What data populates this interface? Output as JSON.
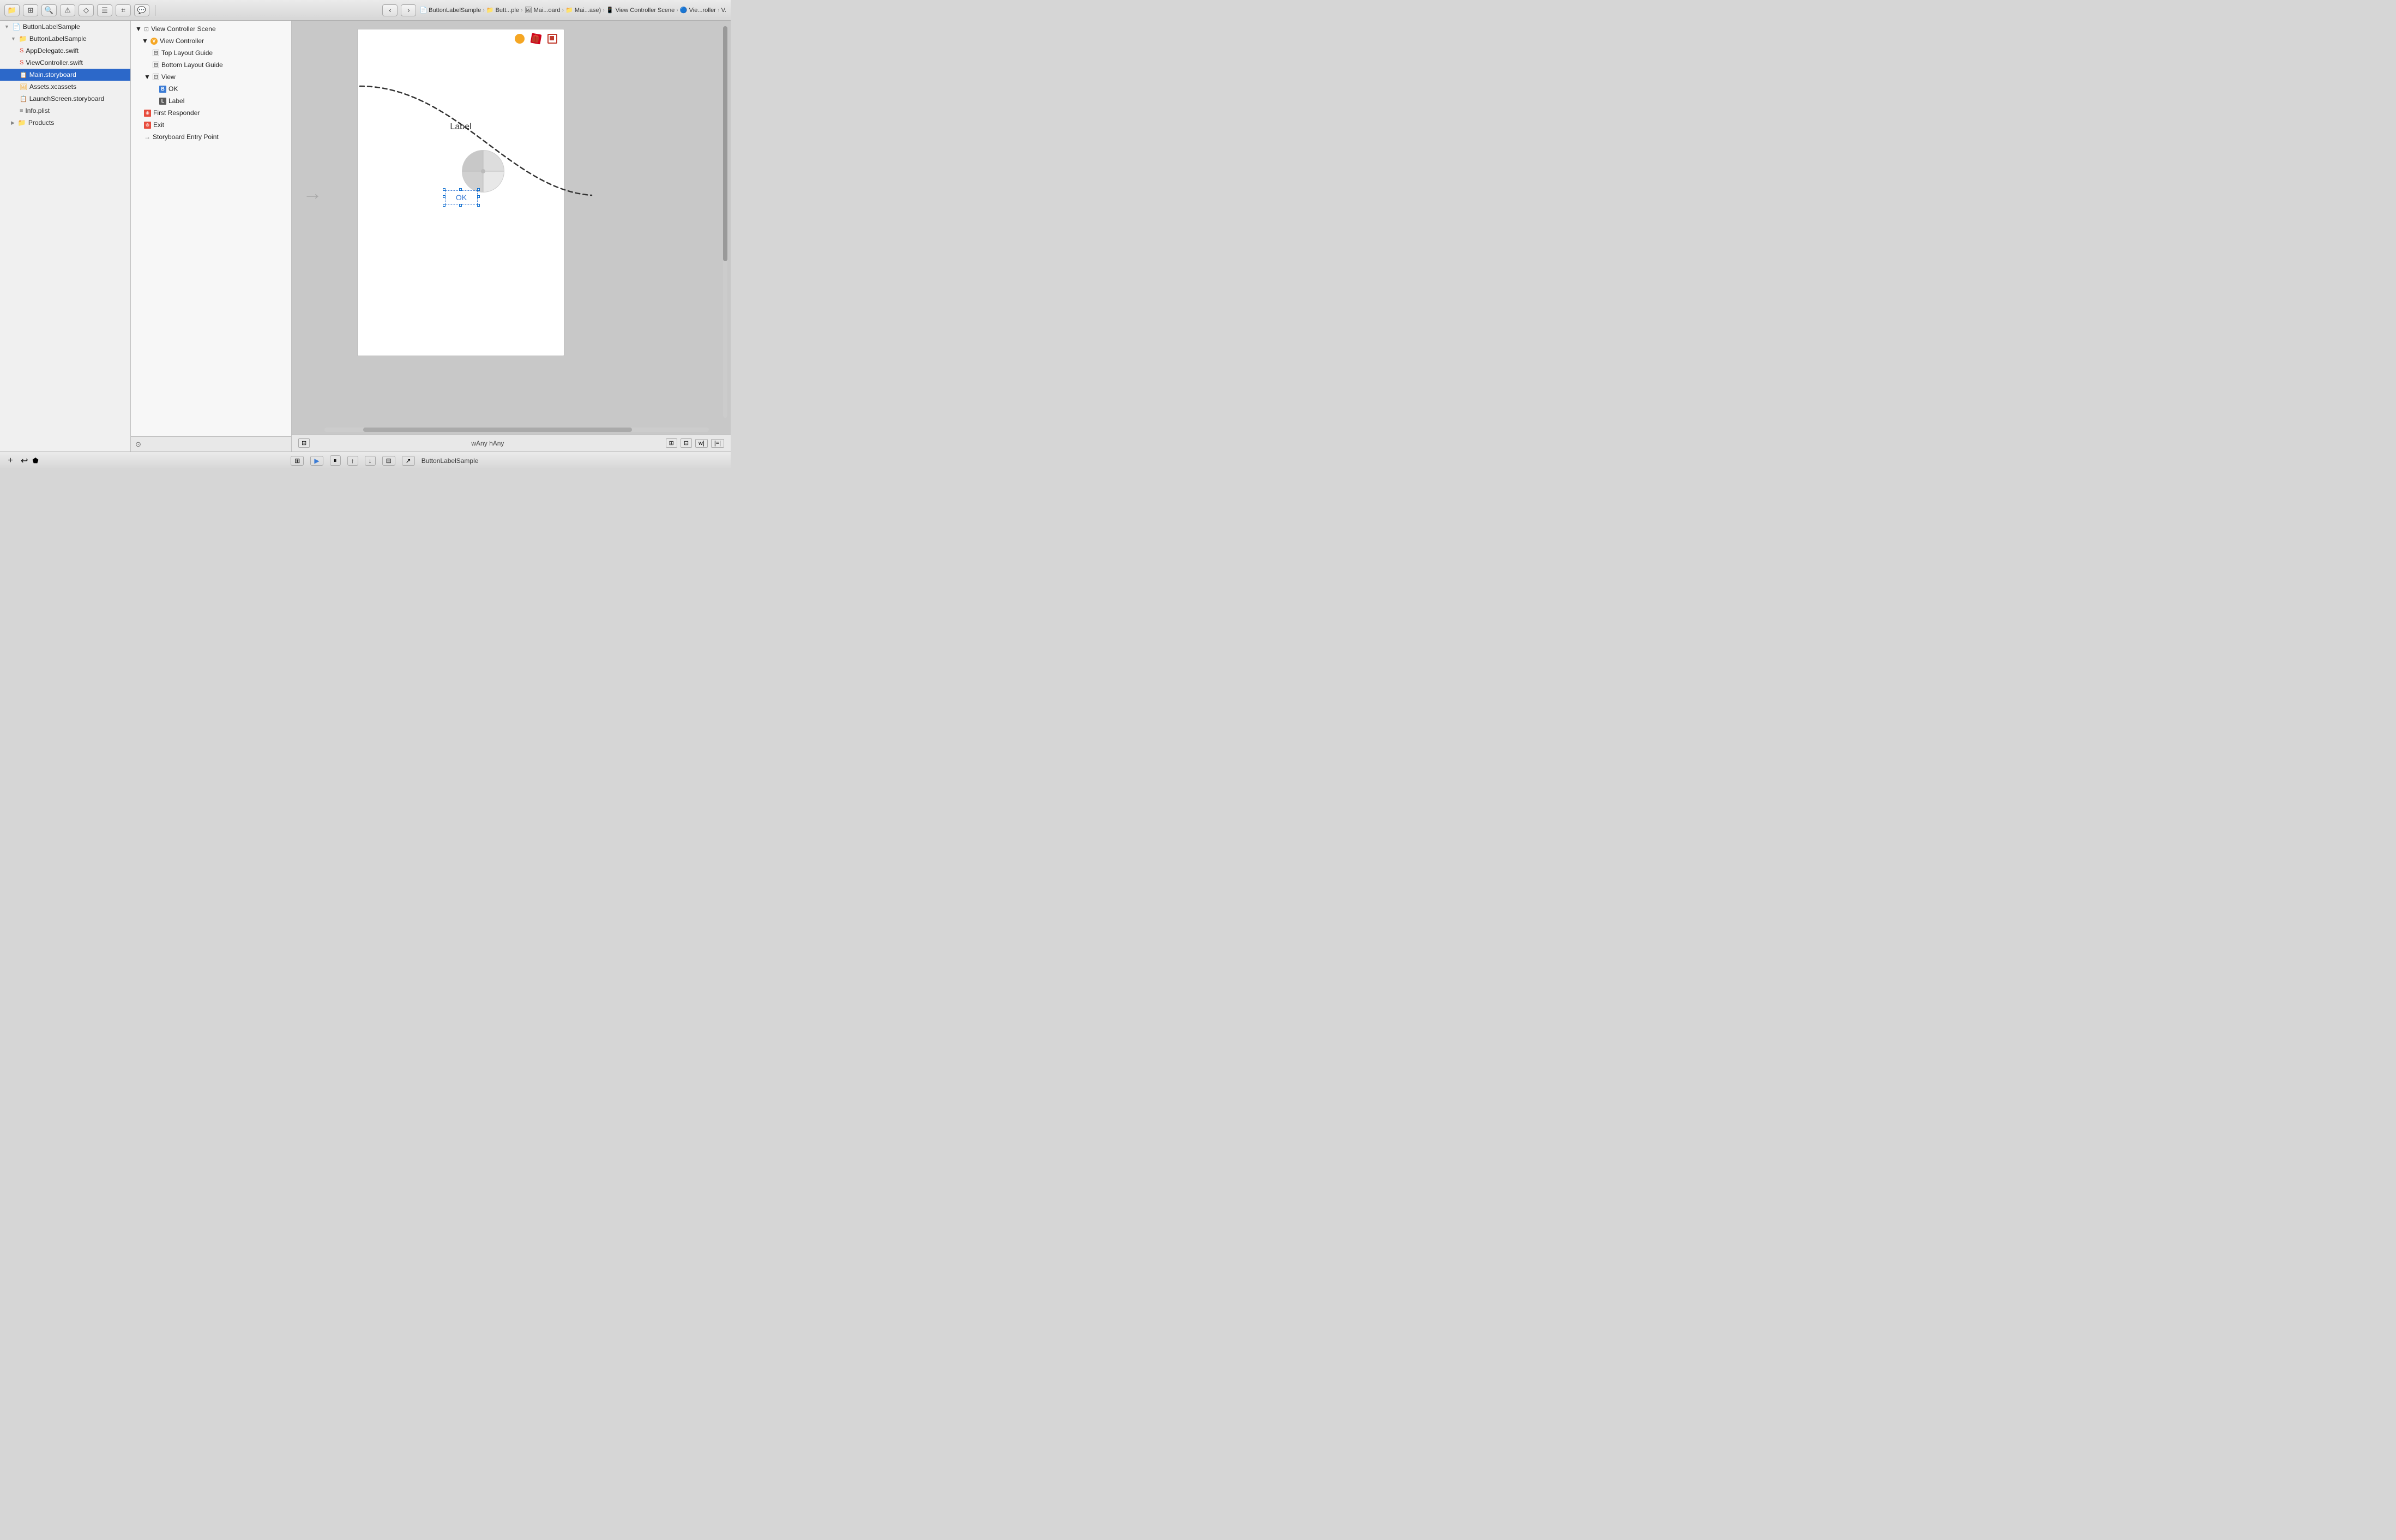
{
  "toolbar": {
    "buttons": [
      {
        "name": "folder-icon",
        "symbol": "📁"
      },
      {
        "name": "hierarchy-icon",
        "symbol": "⊞"
      },
      {
        "name": "search-icon",
        "symbol": "🔍"
      },
      {
        "name": "warning-icon",
        "symbol": "⚠"
      },
      {
        "name": "git-icon",
        "symbol": "◇"
      },
      {
        "name": "list-icon",
        "symbol": "☰"
      },
      {
        "name": "link-icon",
        "symbol": "⌗"
      },
      {
        "name": "comment-icon",
        "symbol": "💬"
      }
    ],
    "nav_back": "‹",
    "nav_forward": "›"
  },
  "breadcrumb": {
    "items": [
      {
        "label": "ButtonLabelSample",
        "icon": "📄"
      },
      {
        "label": "Butt...ple",
        "icon": "📁"
      },
      {
        "label": "Mai...oard",
        "icon": "🖼"
      },
      {
        "label": "Mai...ase)",
        "icon": "📁"
      },
      {
        "label": "View Controller Scene",
        "icon": "📱"
      },
      {
        "label": "Vie...roller",
        "icon": "🔵"
      },
      {
        "label": "V.",
        "icon": ""
      }
    ]
  },
  "sidebar": {
    "title": "ButtonLabelSample",
    "items": [
      {
        "id": "root",
        "label": "ButtonLabelSample",
        "indent": 0,
        "type": "project",
        "open": true
      },
      {
        "id": "group",
        "label": "ButtonLabelSample",
        "indent": 1,
        "type": "folder",
        "open": true
      },
      {
        "id": "appdelegate",
        "label": "AppDelegate.swift",
        "indent": 2,
        "type": "swift"
      },
      {
        "id": "viewcontroller",
        "label": "ViewController.swift",
        "indent": 2,
        "type": "swift"
      },
      {
        "id": "mainstoryboard",
        "label": "Main.storyboard",
        "indent": 2,
        "type": "storyboard",
        "selected": true
      },
      {
        "id": "assets",
        "label": "Assets.xcassets",
        "indent": 2,
        "type": "assets"
      },
      {
        "id": "launchscreen",
        "label": "LaunchScreen.storyboard",
        "indent": 2,
        "type": "storyboard"
      },
      {
        "id": "infoplist",
        "label": "Info.plist",
        "indent": 2,
        "type": "plist"
      },
      {
        "id": "products",
        "label": "Products",
        "indent": 1,
        "type": "folder-closed"
      }
    ]
  },
  "outline": {
    "items": [
      {
        "id": "vc-scene",
        "label": "View Controller Scene",
        "indent": 0,
        "icon": "scene",
        "open": true
      },
      {
        "id": "vc",
        "label": "View Controller",
        "indent": 1,
        "icon": "vc",
        "open": true
      },
      {
        "id": "top-layout",
        "label": "Top Layout Guide",
        "indent": 2,
        "icon": "box"
      },
      {
        "id": "bottom-layout",
        "label": "Bottom Layout Guide",
        "indent": 2,
        "icon": "box"
      },
      {
        "id": "view",
        "label": "View",
        "indent": 2,
        "icon": "box",
        "open": true
      },
      {
        "id": "ok-btn",
        "label": "OK",
        "indent": 3,
        "icon": "button"
      },
      {
        "id": "label",
        "label": "Label",
        "indent": 3,
        "icon": "label"
      },
      {
        "id": "first-responder",
        "label": "First Responder",
        "indent": 1,
        "icon": "responder"
      },
      {
        "id": "exit",
        "label": "Exit",
        "indent": 1,
        "icon": "exit"
      },
      {
        "id": "entry-point",
        "label": "Storyboard Entry Point",
        "indent": 1,
        "icon": "arrow"
      }
    ]
  },
  "canvas": {
    "label_text": "Label",
    "ok_button_label": "OK",
    "size_label": "wAny hAny",
    "icons": [
      {
        "name": "circle-icon",
        "color": "#f5a623"
      },
      {
        "name": "cube-icon",
        "color": "#d0021b"
      },
      {
        "name": "square-icon",
        "color": "#c0392b"
      }
    ]
  },
  "bottom_toolbar": {
    "buttons": [
      {
        "name": "add-button",
        "symbol": "+"
      },
      {
        "name": "back-icon",
        "symbol": "↩"
      },
      {
        "name": "issues-icon",
        "symbol": "⬟"
      }
    ],
    "app_name": "ButtonLabelSample",
    "right_buttons": [
      {
        "name": "image-icon",
        "symbol": "⊞"
      },
      {
        "name": "play-icon",
        "symbol": "▶"
      },
      {
        "name": "pause-icon",
        "symbol": "⏸"
      },
      {
        "name": "up-icon",
        "symbol": "↑"
      },
      {
        "name": "down-icon",
        "symbol": "↓"
      },
      {
        "name": "column-icon",
        "symbol": "⊟"
      },
      {
        "name": "pointer-icon",
        "symbol": "↗"
      },
      {
        "name": "app-name-label",
        "symbol": "ButtonLabelSample"
      }
    ]
  }
}
